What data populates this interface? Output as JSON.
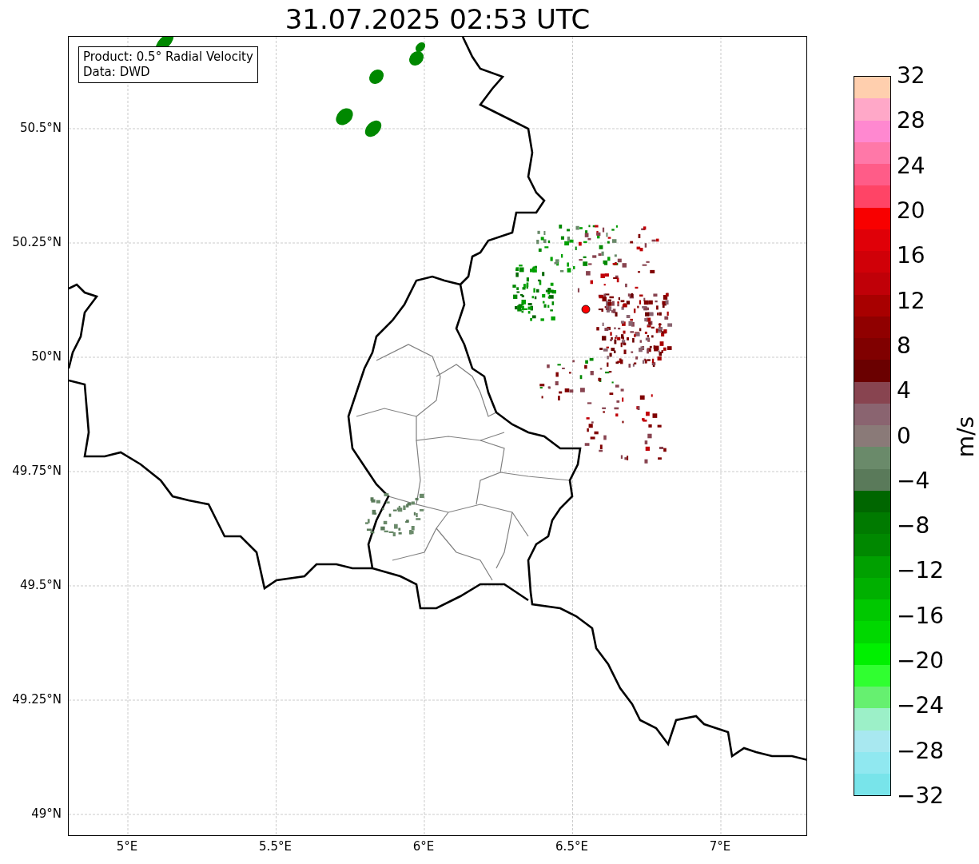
{
  "title": "31.07.2025 02:53 UTC",
  "info_box": [
    "Product: 0.5° Radial Velocity",
    "Data: DWD"
  ],
  "map": {
    "x_ticks": [
      "5°E",
      "5.5°E",
      "6°E",
      "6.5°E",
      "7°E"
    ],
    "y_ticks": [
      "50.5°N",
      "50.25°N",
      "50°N",
      "49.75°N",
      "49.5°N",
      "49.25°N",
      "49°N"
    ]
  },
  "colorbar": {
    "label": "m/s",
    "ticks": [
      "32",
      "28",
      "24",
      "20",
      "16",
      "12",
      "8",
      "4",
      "0",
      "−4",
      "−8",
      "−12",
      "−16",
      "−20",
      "−24",
      "−28",
      "−32"
    ],
    "segments": [
      {
        "color": "#ffcfae"
      },
      {
        "color": "#ffa8c8"
      },
      {
        "color": "#ff88d0"
      },
      {
        "color": "#ff78a8"
      },
      {
        "color": "#ff5c88"
      },
      {
        "color": "#ff4466"
      },
      {
        "color": "#f80000"
      },
      {
        "color": "#e00008"
      },
      {
        "color": "#d00008"
      },
      {
        "color": "#c00008"
      },
      {
        "color": "#a80000"
      },
      {
        "color": "#900000"
      },
      {
        "color": "#800000"
      },
      {
        "color": "#6a0000"
      },
      {
        "color": "#884450"
      },
      {
        "color": "#8a6470"
      },
      {
        "color": "#8a7a78"
      },
      {
        "color": "#6a8a6a"
      },
      {
        "color": "#5a7a5a"
      },
      {
        "color": "#006600"
      },
      {
        "color": "#007a00"
      },
      {
        "color": "#008800"
      },
      {
        "color": "#00a000"
      },
      {
        "color": "#00b000"
      },
      {
        "color": "#00c800"
      },
      {
        "color": "#00d800"
      },
      {
        "color": "#00f000"
      },
      {
        "color": "#30ff30"
      },
      {
        "color": "#66f070"
      },
      {
        "color": "#9cf0c8"
      },
      {
        "color": "#a8e8f0"
      },
      {
        "color": "#90e8f0"
      },
      {
        "color": "#78e4ea"
      }
    ]
  }
}
